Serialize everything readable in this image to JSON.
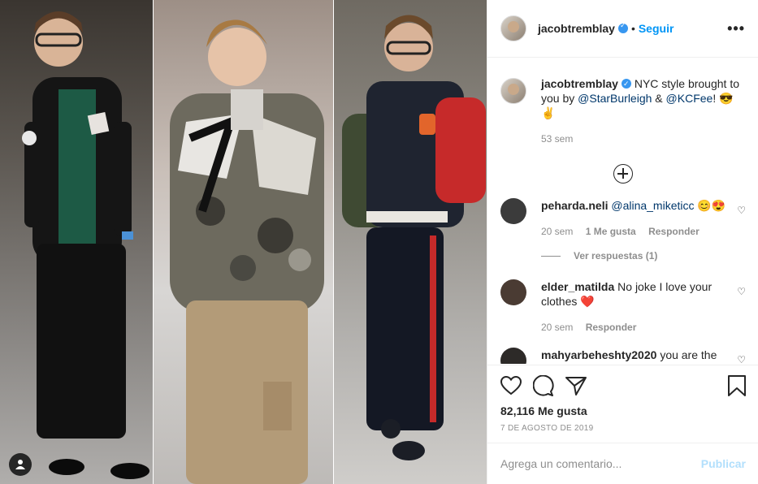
{
  "post": {
    "username": "jacobtremblay",
    "follow_label": "Seguir",
    "separator": "•",
    "more_label": "•••"
  },
  "caption": {
    "username": "jacobtremblay",
    "text_before": "NYC style brought to you by ",
    "mention1": "@StarBurleigh",
    "text_mid": " & ",
    "mention2": "@KCFee",
    "text_after": "! 😎✌️",
    "time": "53 sem"
  },
  "comments": [
    {
      "username": "peharda.neli",
      "mention": "@alina_miketicc",
      "text": " 😊😍",
      "time": "20 sem",
      "likes": "1 Me gusta",
      "reply": "Responder",
      "view_replies": "Ver respuestas (1)",
      "avatar_color": "#3b3b3b"
    },
    {
      "username": "elder_matilda",
      "text": "No joke I love your clothes ❤️",
      "time": "20 sem",
      "reply": "Responder",
      "avatar_color": "#4a3b33"
    },
    {
      "username": "mahyarbeheshty2020",
      "text": "you are the",
      "avatar_color": "#2d2a28"
    }
  ],
  "likes_label": "82,116 Me gusta",
  "date_label": "7 de agosto de 2019",
  "comment_input": {
    "placeholder": "Agrega un comentario...",
    "publish_label": "Publicar"
  },
  "colors": {
    "link": "#0095f6",
    "mention": "#00376b",
    "muted": "#8e8e8e",
    "verified": "#3897f0"
  },
  "icons": [
    "user-tag-icon",
    "more-options-icon",
    "verified-badge-icon",
    "load-more-icon",
    "heart-icon",
    "comment-icon",
    "share-icon",
    "bookmark-icon"
  ]
}
